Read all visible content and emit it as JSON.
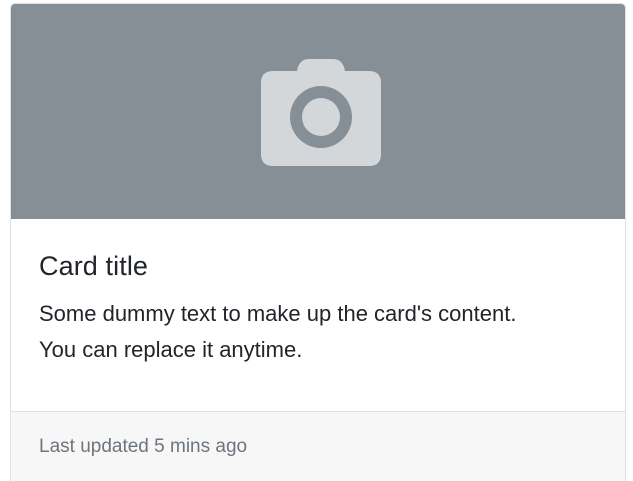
{
  "card": {
    "image_icon": "camera-icon",
    "title": "Card title",
    "text": "Some dummy text to make up the card's content. You can replace it anytime.",
    "footer": "Last updated 5 mins ago"
  },
  "colors": {
    "image_background": "#868e96",
    "icon_fill": "#d4d7da",
    "footer_background": "#f7f7f7",
    "footer_text": "#6c757d"
  }
}
